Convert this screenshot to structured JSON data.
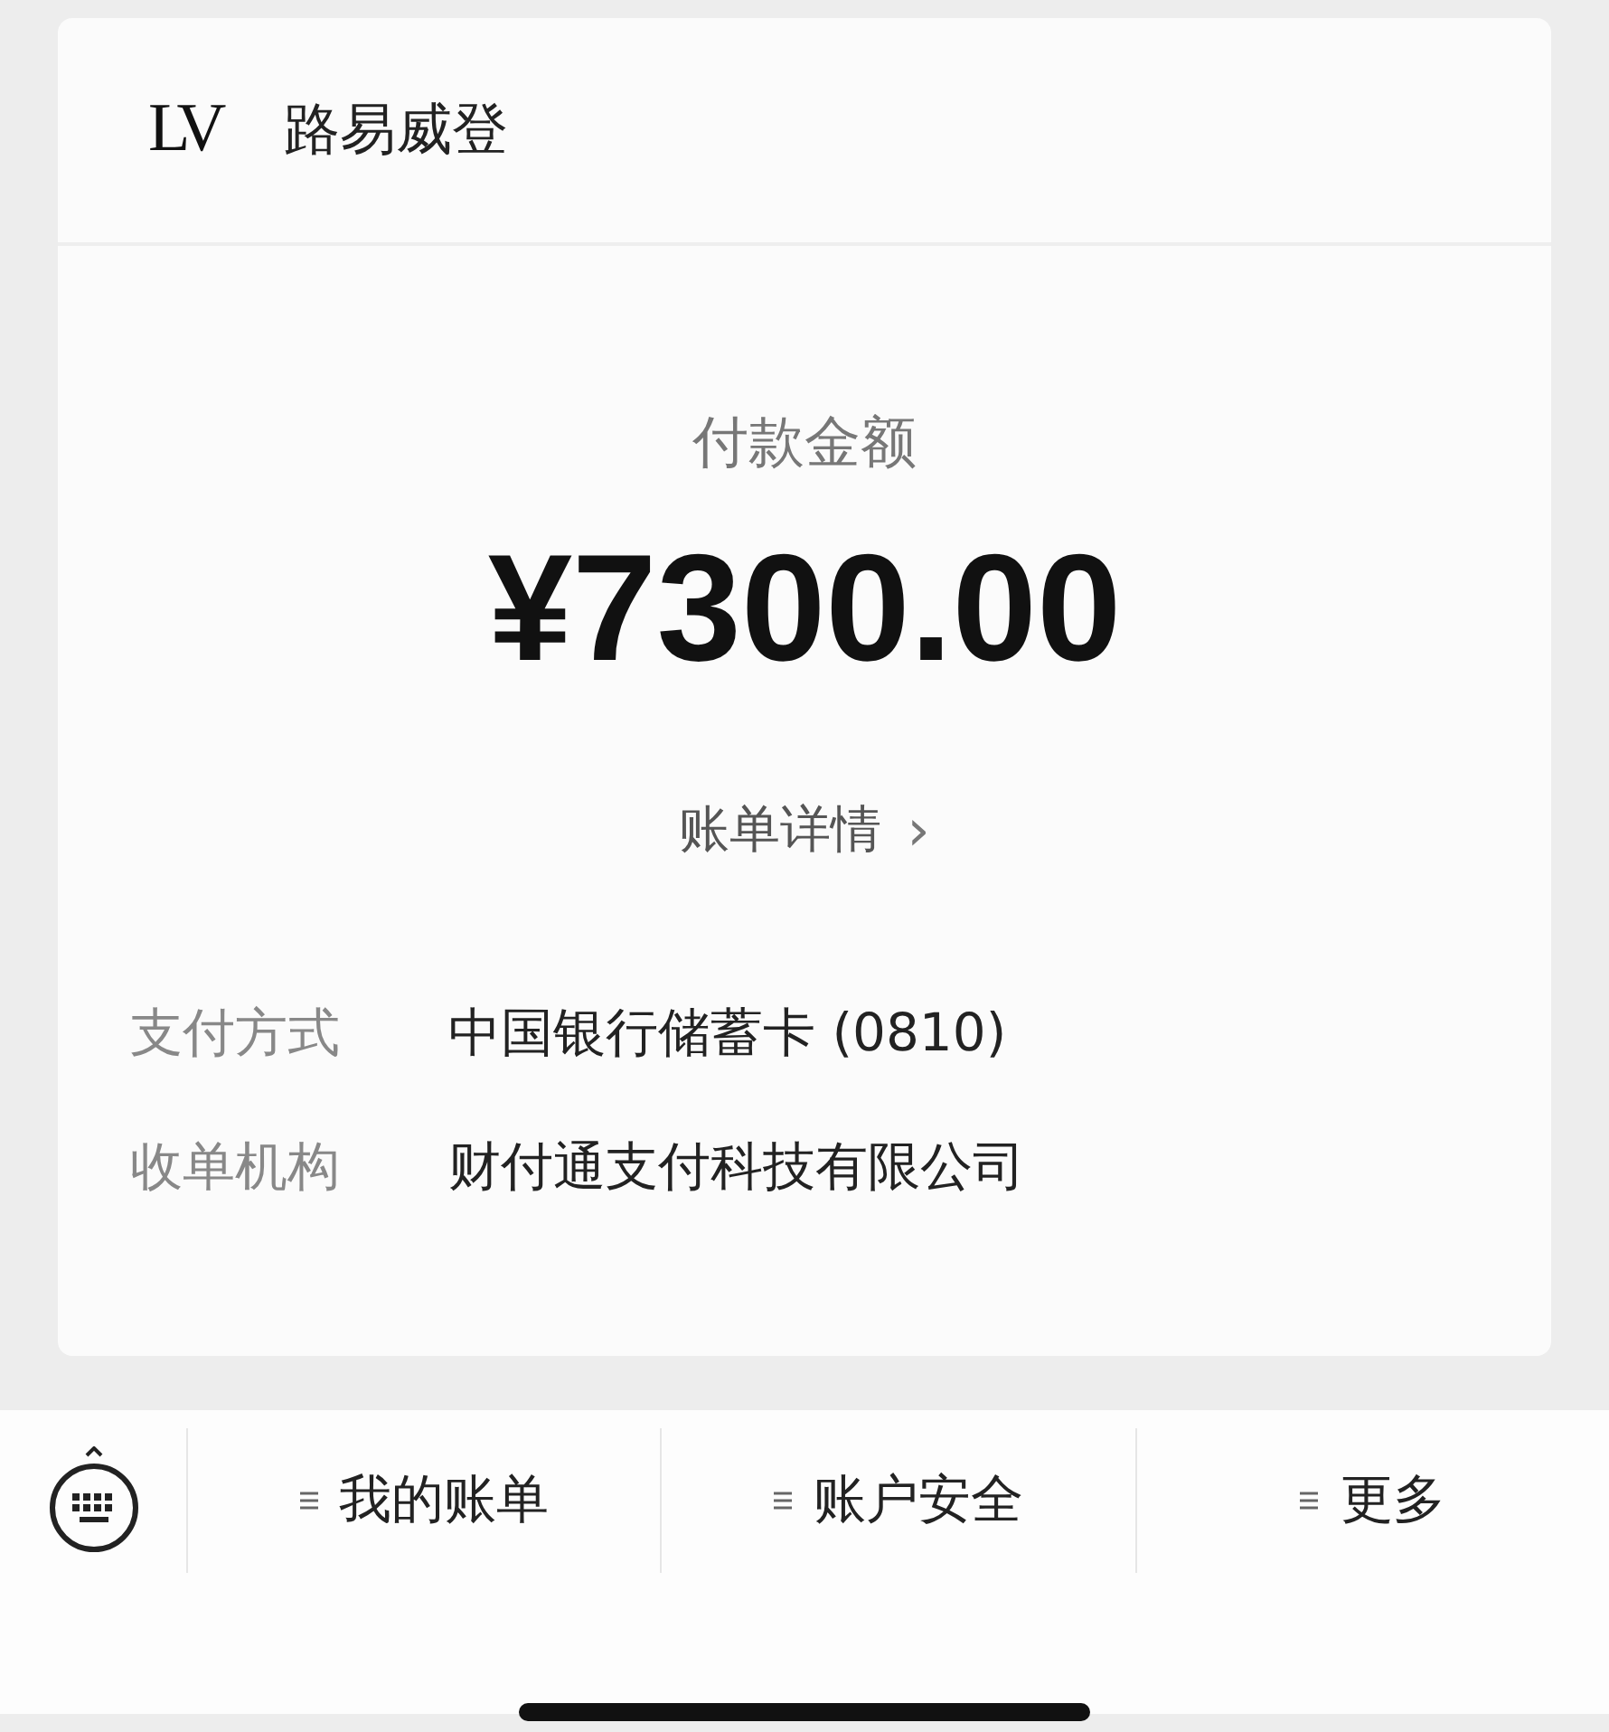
{
  "merchant": {
    "logo": "LV",
    "name": "路易威登"
  },
  "payment": {
    "label": "付款金额",
    "amount": "¥7300.00",
    "details_link": "账单详情",
    "details_chevron": "›"
  },
  "info_rows": [
    {
      "label": "支付方式",
      "value": "中国银行储蓄卡 (0810)"
    },
    {
      "label": "收单机构",
      "value": "财付通支付科技有限公司"
    }
  ],
  "bottom_menu": [
    {
      "label": "我的账单"
    },
    {
      "label": "账户安全"
    },
    {
      "label": "更多"
    }
  ]
}
